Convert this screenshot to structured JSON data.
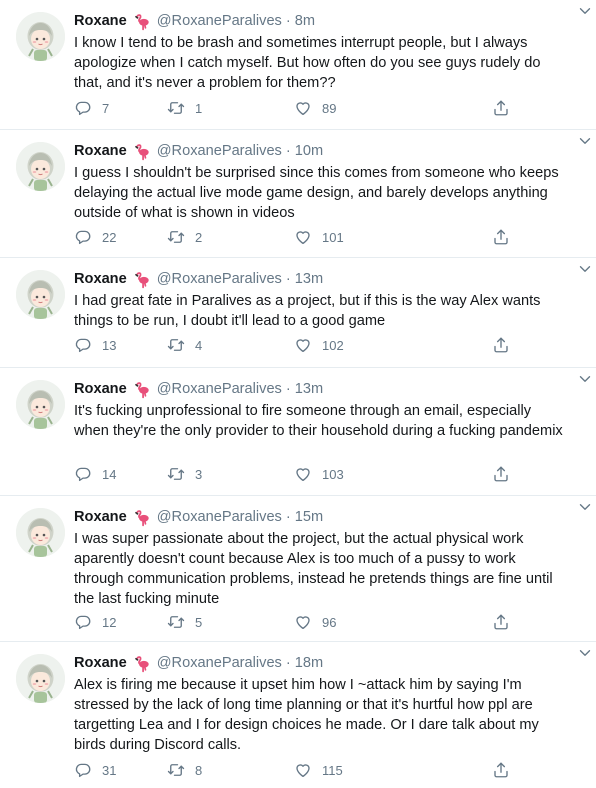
{
  "colors": {
    "text_primary": "#14171a",
    "text_secondary": "#657786",
    "divider": "#e6ecf0",
    "flamingo_emoji": "#e8507a"
  },
  "tweets": [
    {
      "name": "Roxane",
      "badge_icon": "flamingo-emoji",
      "handle": "@RoxaneParalives",
      "separator": "·",
      "time": "8m",
      "text": "I know I tend to be brash and sometimes interrupt people, but I always apologize when I catch myself. But how often do you see guys rudely do that, and it's never a problem for them??",
      "replies": "7",
      "retweets": "1",
      "likes": "89"
    },
    {
      "name": "Roxane",
      "badge_icon": "flamingo-emoji",
      "handle": "@RoxaneParalives",
      "separator": "·",
      "time": "10m",
      "text": "I guess I shouldn't be surprised since this comes from someone who keeps delaying the actual live mode game design, and barely develops anything outside of what is shown in videos",
      "replies": "22",
      "retweets": "2",
      "likes": "101"
    },
    {
      "name": "Roxane",
      "badge_icon": "flamingo-emoji",
      "handle": "@RoxaneParalives",
      "separator": "·",
      "time": "13m",
      "text": "I had great fate in Paralives as a project, but if this is the way Alex wants things to be run, I doubt it'll lead to a good game",
      "replies": "13",
      "retweets": "4",
      "likes": "102"
    },
    {
      "name": "Roxane",
      "badge_icon": "flamingo-emoji",
      "handle": "@RoxaneParalives",
      "separator": "·",
      "time": "13m",
      "text": "It's fucking unprofessional to fire someone through an email, especially when they're the only provider to their household during a fucking pandemix",
      "replies": "14",
      "retweets": "3",
      "likes": "103"
    },
    {
      "name": "Roxane",
      "badge_icon": "flamingo-emoji",
      "handle": "@RoxaneParalives",
      "separator": "·",
      "time": "15m",
      "text": "I was super passionate about the project, but the actual physical work aparently doesn't count because Alex is too much of a pussy to work through communication problems, instead he pretends things are fine until the last fucking minute",
      "replies": "12",
      "retweets": "5",
      "likes": "96"
    },
    {
      "name": "Roxane",
      "badge_icon": "flamingo-emoji",
      "handle": "@RoxaneParalives",
      "separator": "·",
      "time": "18m",
      "text": "Alex is firing me because it upset him how I ~attack him by saying I'm stressed by the lack of long time planning or that it's hurtful how ppl are targetting Lea and I for design choices he made. Or I dare talk about my birds during Discord calls.",
      "replies": "31",
      "retweets": "8",
      "likes": "115"
    }
  ]
}
